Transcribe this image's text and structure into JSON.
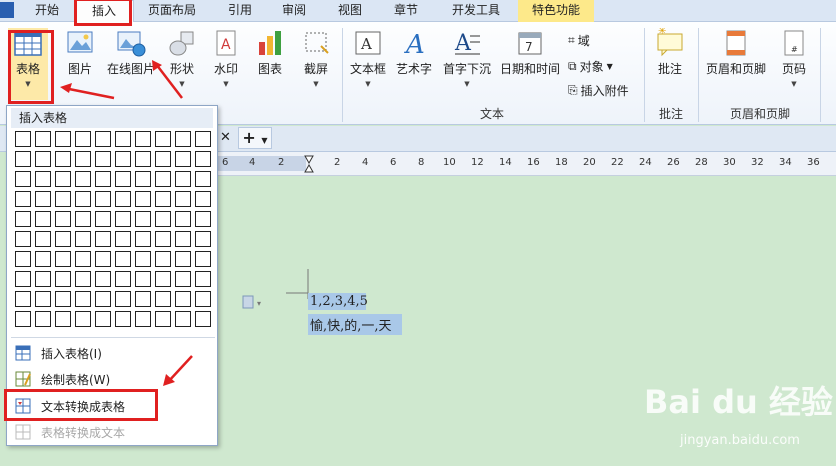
{
  "tabs": [
    "开始",
    "插入",
    "页面布局",
    "引用",
    "审阅",
    "视图",
    "章节",
    "开发工具",
    "特色功能"
  ],
  "ribbon": {
    "table": "表格",
    "picture": "图片",
    "online_picture": "在线图片",
    "shape": "形状",
    "watermark": "水印",
    "chart": "图表",
    "screenshot": "截屏",
    "textbox": "文本框",
    "wordart": "艺术字",
    "dropcap": "首字下沉",
    "datetime": "日期和时间",
    "field": "域",
    "object": "对象",
    "attachment": "插入附件",
    "comment": "批注",
    "header_footer": "页眉和页脚",
    "page_number": "页码",
    "group_text": "文本",
    "group_comment": "批注",
    "group_header_footer": "页眉和页脚"
  },
  "dropdown": {
    "title": "插入表格",
    "items": [
      {
        "label": "插入表格(I)",
        "icon": "table-icon",
        "disabled": false
      },
      {
        "label": "绘制表格(W)",
        "icon": "draw-table-icon",
        "disabled": false
      },
      {
        "label": "文本转换成表格",
        "icon": "text-to-table-icon",
        "disabled": false
      },
      {
        "label": "表格转换成文本",
        "icon": "table-to-text-icon",
        "disabled": true
      }
    ]
  },
  "document": {
    "line1": "1,2,3,4,5",
    "line2": "愉,快,的,一,天"
  },
  "ruler_numbers": [
    "6",
    "4",
    "2",
    "2",
    "4",
    "6",
    "8",
    "10",
    "12",
    "14",
    "16",
    "18",
    "20",
    "22",
    "24",
    "26",
    "28",
    "30",
    "32",
    "34",
    "36"
  ],
  "watermark": {
    "brand": "Bai du 经验",
    "site": "jingyan.baidu.com"
  },
  "colors": {
    "highlight": "#e02020",
    "ribbon_bg": "#eef3fa",
    "special_tab": "#fde98a",
    "selection": "#a9c8e8",
    "doc_bg": "#cfe8cf"
  }
}
